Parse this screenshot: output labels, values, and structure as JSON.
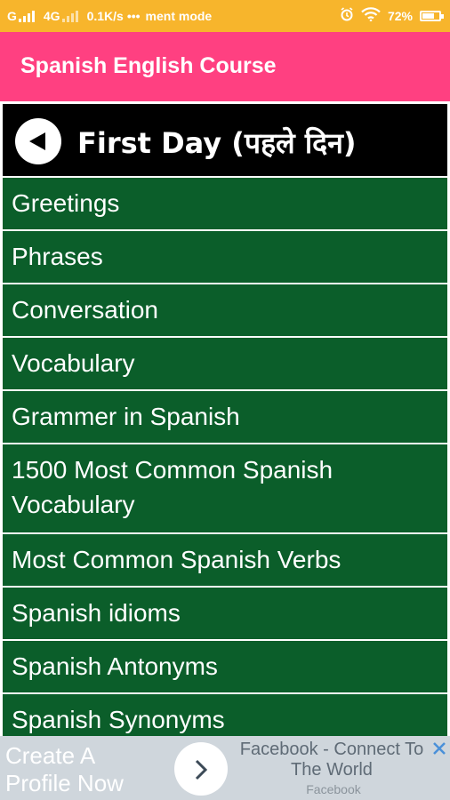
{
  "status_bar": {
    "carrier": "G",
    "network": "4G",
    "speed": "0.1K/s",
    "dots": "•••",
    "notification": "ment mode",
    "battery": "72%",
    "battery_level": 0.72
  },
  "app_bar": {
    "title": "Spanish English Course"
  },
  "section": {
    "title": "First Day (पहले दिन)"
  },
  "list": {
    "items": [
      {
        "label": "Greetings"
      },
      {
        "label": "Phrases"
      },
      {
        "label": "Conversation"
      },
      {
        "label": "Vocabulary"
      },
      {
        "label": "Grammer in Spanish"
      },
      {
        "label": "1500 Most Common Spanish Vocabulary"
      },
      {
        "label": "Most Common Spanish Verbs"
      },
      {
        "label": "Spanish idioms"
      },
      {
        "label": "Spanish Antonyms"
      },
      {
        "label": "Spanish Synonyms"
      }
    ]
  },
  "ad": {
    "left_line1": "Create A",
    "left_line2": "Profile Now",
    "right_title": "Facebook - Connect To The World",
    "source": "Facebook"
  },
  "colors": {
    "status_bar": "#f7b52c",
    "app_bar": "#ff4081",
    "list_item": "#0b5e2a",
    "header": "#000000"
  }
}
